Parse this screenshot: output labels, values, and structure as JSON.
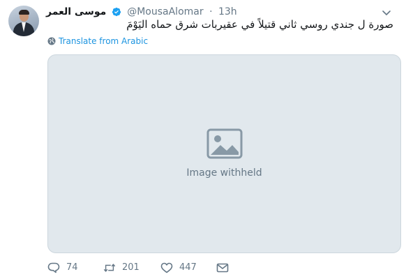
{
  "author": {
    "display_name": "موسى العمر",
    "handle": "@MousaAlomar",
    "separator": "·",
    "time": "13h",
    "verified": true
  },
  "tweet": {
    "text": "صورة ل جندي روسي ثاني قتيلاً في عقيربات شرق حماه اليَوْمَ",
    "translate_label": "Translate from Arabic"
  },
  "media": {
    "withheld_label": "Image withheld"
  },
  "actions": {
    "replies": "74",
    "retweets": "201",
    "likes": "447"
  },
  "colors": {
    "link_blue": "#1c94e0",
    "muted_text": "#657786",
    "verified_blue": "#1da1f2"
  },
  "icons": {
    "verified": "verified-badge-icon",
    "caret": "chevron-down-icon",
    "translate": "globe-icon",
    "reply": "reply-icon",
    "retweet": "retweet-icon",
    "like": "heart-icon",
    "dm": "envelope-icon"
  }
}
